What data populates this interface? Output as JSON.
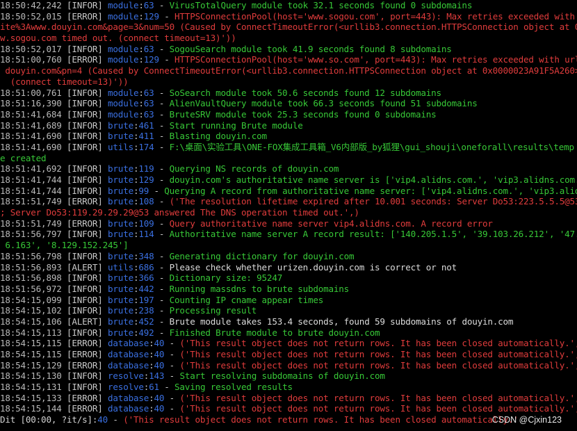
{
  "watermark": "CSDN @Cjxin123",
  "lines": [
    {
      "type": "log",
      "ts": "18:50:42,242",
      "level": "INFOR",
      "mod": "module",
      "ln": "63",
      "msg": "VirusTotalQuery module took 32.1 seconds found 0 subdomains"
    },
    {
      "type": "log",
      "ts": "18:50:52,015",
      "level": "ERROR",
      "mod": "module",
      "ln": "129",
      "msg": "HTTPSConnectionPool(host='www.sogou.com', port=443): Max retries exceeded with url: /w"
    },
    {
      "type": "cont",
      "level": "ERROR",
      "text": "ite%3Awww.douyin.com&page=3&num=50 (Caused by ConnectTimeoutError(<urllib3.connection.HTTPSConnection object at 0x000002"
    },
    {
      "type": "cont",
      "level": "ERROR",
      "text": "w.sogou.com timed out. (connect timeout=13)'))"
    },
    {
      "type": "log",
      "ts": "18:50:52,017",
      "level": "INFOR",
      "mod": "module",
      "ln": "63",
      "msg": "SogouSearch module took 41.9 seconds found 8 subdomains"
    },
    {
      "type": "log",
      "ts": "18:51:00,760",
      "level": "ERROR",
      "mod": "module",
      "ln": "129",
      "msg": "HTTPSConnectionPool(host='www.so.com', port=443): Max retries exceeded with url: /s?q="
    },
    {
      "type": "cont",
      "level": "ERROR",
      "text": " douyin.com&pn=4 (Caused by ConnectTimeoutError(<urllib3.connection.HTTPSConnection object at 0x0000023A91F5A260>, 'Conn"
    },
    {
      "type": "cont",
      "level": "ERROR",
      "text": "  (connect timeout=13)'))"
    },
    {
      "type": "log",
      "ts": "18:51:00,761",
      "level": "INFOR",
      "mod": "module",
      "ln": "63",
      "msg": "SoSearch module took 50.6 seconds found 12 subdomains"
    },
    {
      "type": "log",
      "ts": "18:51:16,390",
      "level": "INFOR",
      "mod": "module",
      "ln": "63",
      "msg": "AlienVaultQuery module took 66.3 seconds found 51 subdomains"
    },
    {
      "type": "log",
      "ts": "18:51:41,684",
      "level": "INFOR",
      "mod": "module",
      "ln": "63",
      "msg": "BruteSRV module took 25.3 seconds found 0 subdomains"
    },
    {
      "type": "log",
      "ts": "18:51:41,689",
      "level": "INFOR",
      "mod": "brute",
      "ln": "461",
      "msg": "Start running Brute module"
    },
    {
      "type": "log",
      "ts": "18:51:41,690",
      "level": "INFOR",
      "mod": "brute",
      "ln": "411",
      "msg": "Blasting douyin.com"
    },
    {
      "type": "log",
      "ts": "18:51:41,690",
      "level": "INFOR",
      "mod": "utils",
      "ln": "174",
      "msg": "F:\\桌面\\实验工具\\ONE-FOX集成工具箱_V6内部版_by狐狸\\gui_shouji\\oneforall\\results\\temp de"
    },
    {
      "type": "cont",
      "level": "INFOR",
      "text": "e created"
    },
    {
      "type": "log",
      "ts": "18:51:41,692",
      "level": "INFOR",
      "mod": "brute",
      "ln": "119",
      "msg": "Querying NS records of douyin.com"
    },
    {
      "type": "log",
      "ts": "18:51:41,744",
      "level": "INFOR",
      "mod": "brute",
      "ln": "129",
      "msg": "douyin.com's authoritative name server is ['vip4.alidns.com.', 'vip3.alidns.com.']"
    },
    {
      "type": "log",
      "ts": "18:51:41,744",
      "level": "INFOR",
      "mod": "brute",
      "ln": "99",
      "msg": "Querying A record from authoritative name server: ['vip4.alidns.com.', 'vip3.alidns.com."
    },
    {
      "type": "log",
      "ts": "18:51:51,749",
      "level": "ERROR",
      "mod": "brute",
      "ln": "108",
      "msg": "('The resolution lifetime expired after 10.001 seconds: Server Do53:223.5.5.5@53 answer"
    },
    {
      "type": "cont",
      "level": "ERROR",
      "text": "; Server Do53:119.29.29.29@53 answered The DNS operation timed out.',)"
    },
    {
      "type": "log",
      "ts": "18:51:51,749",
      "level": "ERROR",
      "mod": "brute",
      "ln": "109",
      "msg": "Query authoritative name server vip4.alidns.com. A record error"
    },
    {
      "type": "log",
      "ts": "18:51:56,797",
      "level": "INFOR",
      "mod": "brute",
      "ln": "114",
      "msg": "Authoritative name server A record result: ['140.205.1.5', '39.103.26.212', '47.108.36."
    },
    {
      "type": "cont",
      "level": "INFOR",
      "text": " 6.163', '8.129.152.245']"
    },
    {
      "type": "log",
      "ts": "18:51:56,798",
      "level": "INFOR",
      "mod": "brute",
      "ln": "348",
      "msg": "Generating dictionary for douyin.com"
    },
    {
      "type": "log",
      "ts": "18:51:56,893",
      "level": "ALERT",
      "mod": "utils",
      "ln": "686",
      "msg": "Please check whether urizen.douyin.com is correct or not"
    },
    {
      "type": "log",
      "ts": "18:51:56,898",
      "level": "INFOR",
      "mod": "brute",
      "ln": "366",
      "msg": "Dictionary size: 95247"
    },
    {
      "type": "log",
      "ts": "18:51:56,972",
      "level": "INFOR",
      "mod": "brute",
      "ln": "442",
      "msg": "Running massdns to brute subdomains"
    },
    {
      "type": "log",
      "ts": "18:54:15,099",
      "level": "INFOR",
      "mod": "brute",
      "ln": "197",
      "msg": "Counting IP cname appear times"
    },
    {
      "type": "log",
      "ts": "18:54:15,102",
      "level": "INFOR",
      "mod": "brute",
      "ln": "238",
      "msg": "Processing result"
    },
    {
      "type": "log",
      "ts": "18:54:15,106",
      "level": "ALERT",
      "mod": "brute",
      "ln": "452",
      "msg": "Brute module takes 153.4 seconds, found 59 subdomains of douyin.com"
    },
    {
      "type": "log",
      "ts": "18:54:15,113",
      "level": "INFOR",
      "mod": "brute",
      "ln": "492",
      "msg": "Finished Brute module to brute douyin.com"
    },
    {
      "type": "log",
      "ts": "18:54:15,115",
      "level": "ERROR",
      "mod": "database",
      "ln": "40",
      "msg": "('This result object does not return rows. It has been closed automatically.',)"
    },
    {
      "type": "log",
      "ts": "18:54:15,115",
      "level": "ERROR",
      "mod": "database",
      "ln": "40",
      "msg": "('This result object does not return rows. It has been closed automatically.',)"
    },
    {
      "type": "log",
      "ts": "18:54:15,129",
      "level": "ERROR",
      "mod": "database",
      "ln": "40",
      "msg": "('This result object does not return rows. It has been closed automatically.',)"
    },
    {
      "type": "log",
      "ts": "18:54:15,130",
      "level": "INFOR",
      "mod": "resolve",
      "ln": "143",
      "msg": "Start resolving subdomains of douyin.com"
    },
    {
      "type": "log",
      "ts": "18:54:15,131",
      "level": "INFOR",
      "mod": "resolve",
      "ln": "61",
      "msg": "Saving resolved results"
    },
    {
      "type": "log",
      "ts": "18:54:15,133",
      "level": "ERROR",
      "mod": "database",
      "ln": "40",
      "msg": "('This result object does not return rows. It has been closed automatically.',)"
    },
    {
      "type": "log",
      "ts": "18:54:15,144",
      "level": "ERROR",
      "mod": "database",
      "ln": "40",
      "msg": "('This result object does not return rows. It has been closed automatically.',)"
    },
    {
      "type": "prog",
      "prefix": "Dit [00:00, ?it/s]:",
      "ln": "40",
      "msg": "('This result object does not return rows. It has been closed automatically.'"
    }
  ]
}
